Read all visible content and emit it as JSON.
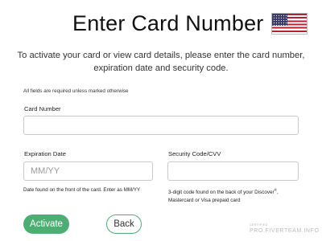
{
  "header": {
    "title": "Enter Card Number",
    "flag_icon": "us-flag-icon"
  },
  "intro": "To activate your card or view card details, please enter the card number, expiration date and security code.",
  "required_note": "All fields are required unless marked otherwise",
  "form": {
    "card_number": {
      "label": "Card Number",
      "value": "",
      "placeholder": ""
    },
    "expiration": {
      "label": "Expiration Date",
      "value": "",
      "placeholder": "MM/YY",
      "help": "Date found on the front of the card. Enter as MM/YY"
    },
    "cvv": {
      "label": "Security Code/CVV",
      "value": "",
      "placeholder": "",
      "help_prefix": "3-digit code found on the back of your Discover",
      "help_mark": "®",
      "help_suffix": ", Mastercard or Visa prepaid card"
    }
  },
  "buttons": {
    "activate": "Activate",
    "back": "Back"
  },
  "colors": {
    "accent": "#4cae72"
  },
  "watermark": {
    "small": "CERTIFIED",
    "big": "PRO.FIVERTEAM.INFO"
  }
}
